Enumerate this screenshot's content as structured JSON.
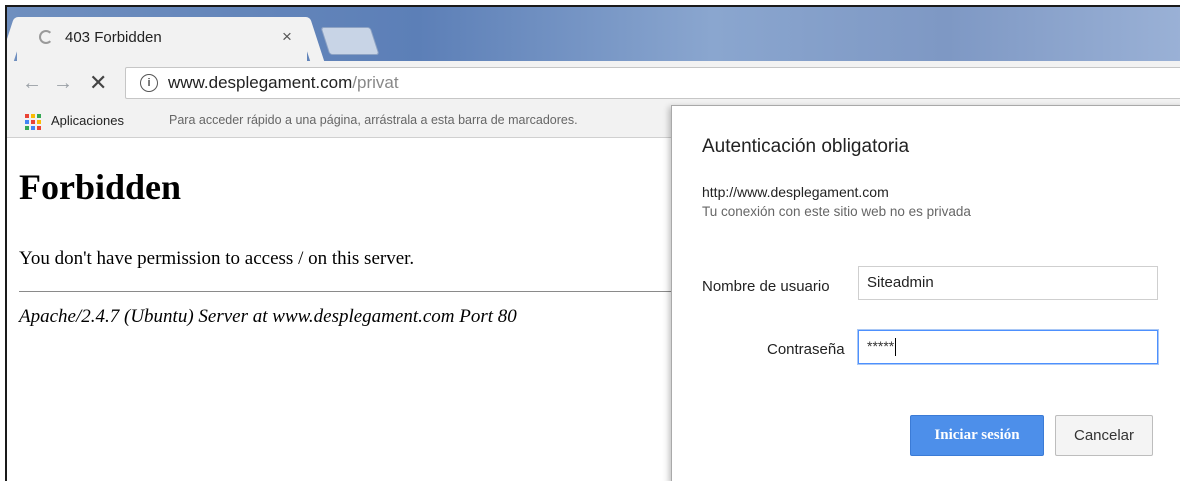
{
  "browser": {
    "tab": {
      "title": "403 Forbidden",
      "close_glyph": "×"
    },
    "toolbar": {
      "back_glyph": "←",
      "forward_glyph": "→",
      "stop_glyph": "✕",
      "info_glyph": "i",
      "url_host": "www.desplegament.com",
      "url_path": "/privat"
    },
    "bookmarks": {
      "apps_label": "Aplicaciones",
      "hint": "Para acceder rápido a una página, arrástrala a esta barra de marcadores."
    }
  },
  "page": {
    "title": "Forbidden",
    "message": "You don't have permission to access / on this server.",
    "footer": "Apache/2.4.7 (Ubuntu) Server at www.desplegament.com Port 80"
  },
  "auth_dialog": {
    "title": "Autenticación obligatoria",
    "host": "http://www.desplegament.com",
    "warning": "Tu conexión con este sitio web no es privada",
    "username_label": "Nombre de usuario",
    "username_value": "Siteadmin",
    "password_label": "Contraseña",
    "password_masked": "*****",
    "login_button": "Iniciar sesión",
    "cancel_button": "Cancelar"
  },
  "colors": {
    "primary_button": "#4d8fea",
    "focus_ring": "#4d90fe",
    "apps_icon": [
      "#ea4335",
      "#fbbc05",
      "#34a853",
      "#4285f4",
      "#ea4335",
      "#fbbc05",
      "#34a853",
      "#4285f4",
      "#ea4335"
    ]
  }
}
